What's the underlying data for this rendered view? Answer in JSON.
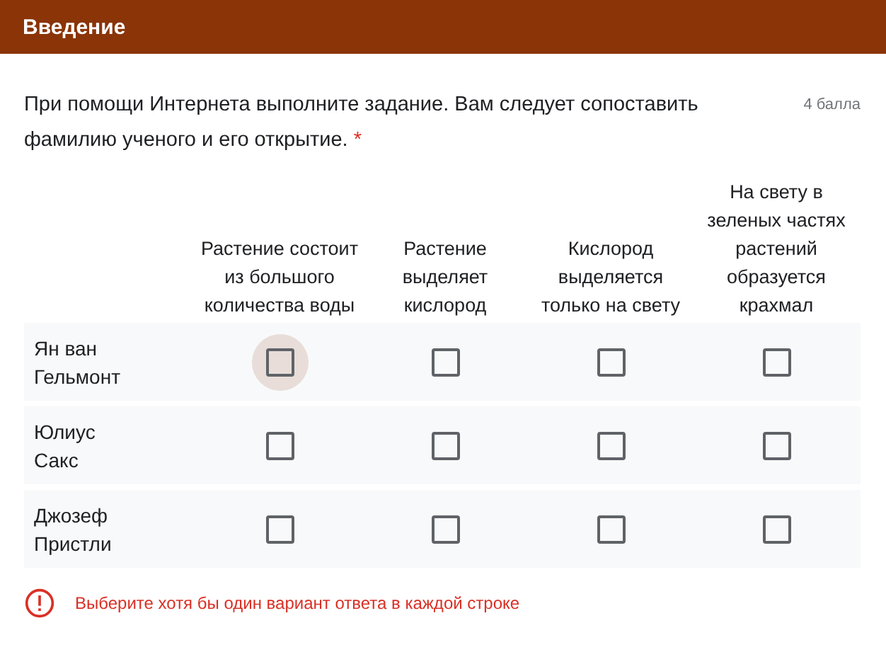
{
  "section": {
    "title": "Введение"
  },
  "question": {
    "text": "При помощи Интернета выполните задание. Вам следует сопоставить фамилию ученого и его открытие.",
    "required_mark": "*",
    "points": "4 балла"
  },
  "columns": [
    "Растение состоит из большого количества воды",
    "Растение выделяет кислород",
    "Кислород выделяется только на свету",
    "На свету в зеленых частях растений образуется крахмал"
  ],
  "rows": [
    {
      "label": "Ян ван Гельмонт",
      "cells": [
        {
          "checked": false,
          "focused": true
        },
        {
          "checked": false,
          "focused": false
        },
        {
          "checked": false,
          "focused": false
        },
        {
          "checked": false,
          "focused": false
        }
      ]
    },
    {
      "label": "Юлиус Сакс",
      "cells": [
        {
          "checked": false,
          "focused": false
        },
        {
          "checked": false,
          "focused": false
        },
        {
          "checked": false,
          "focused": false
        },
        {
          "checked": false,
          "focused": false
        }
      ]
    },
    {
      "label": "Джозеф Пристли",
      "cells": [
        {
          "checked": false,
          "focused": false
        },
        {
          "checked": false,
          "focused": false
        },
        {
          "checked": false,
          "focused": false
        },
        {
          "checked": false,
          "focused": false
        }
      ]
    }
  ],
  "error": {
    "text": "Выберите хотя бы один вариант ответа в каждой строке"
  }
}
